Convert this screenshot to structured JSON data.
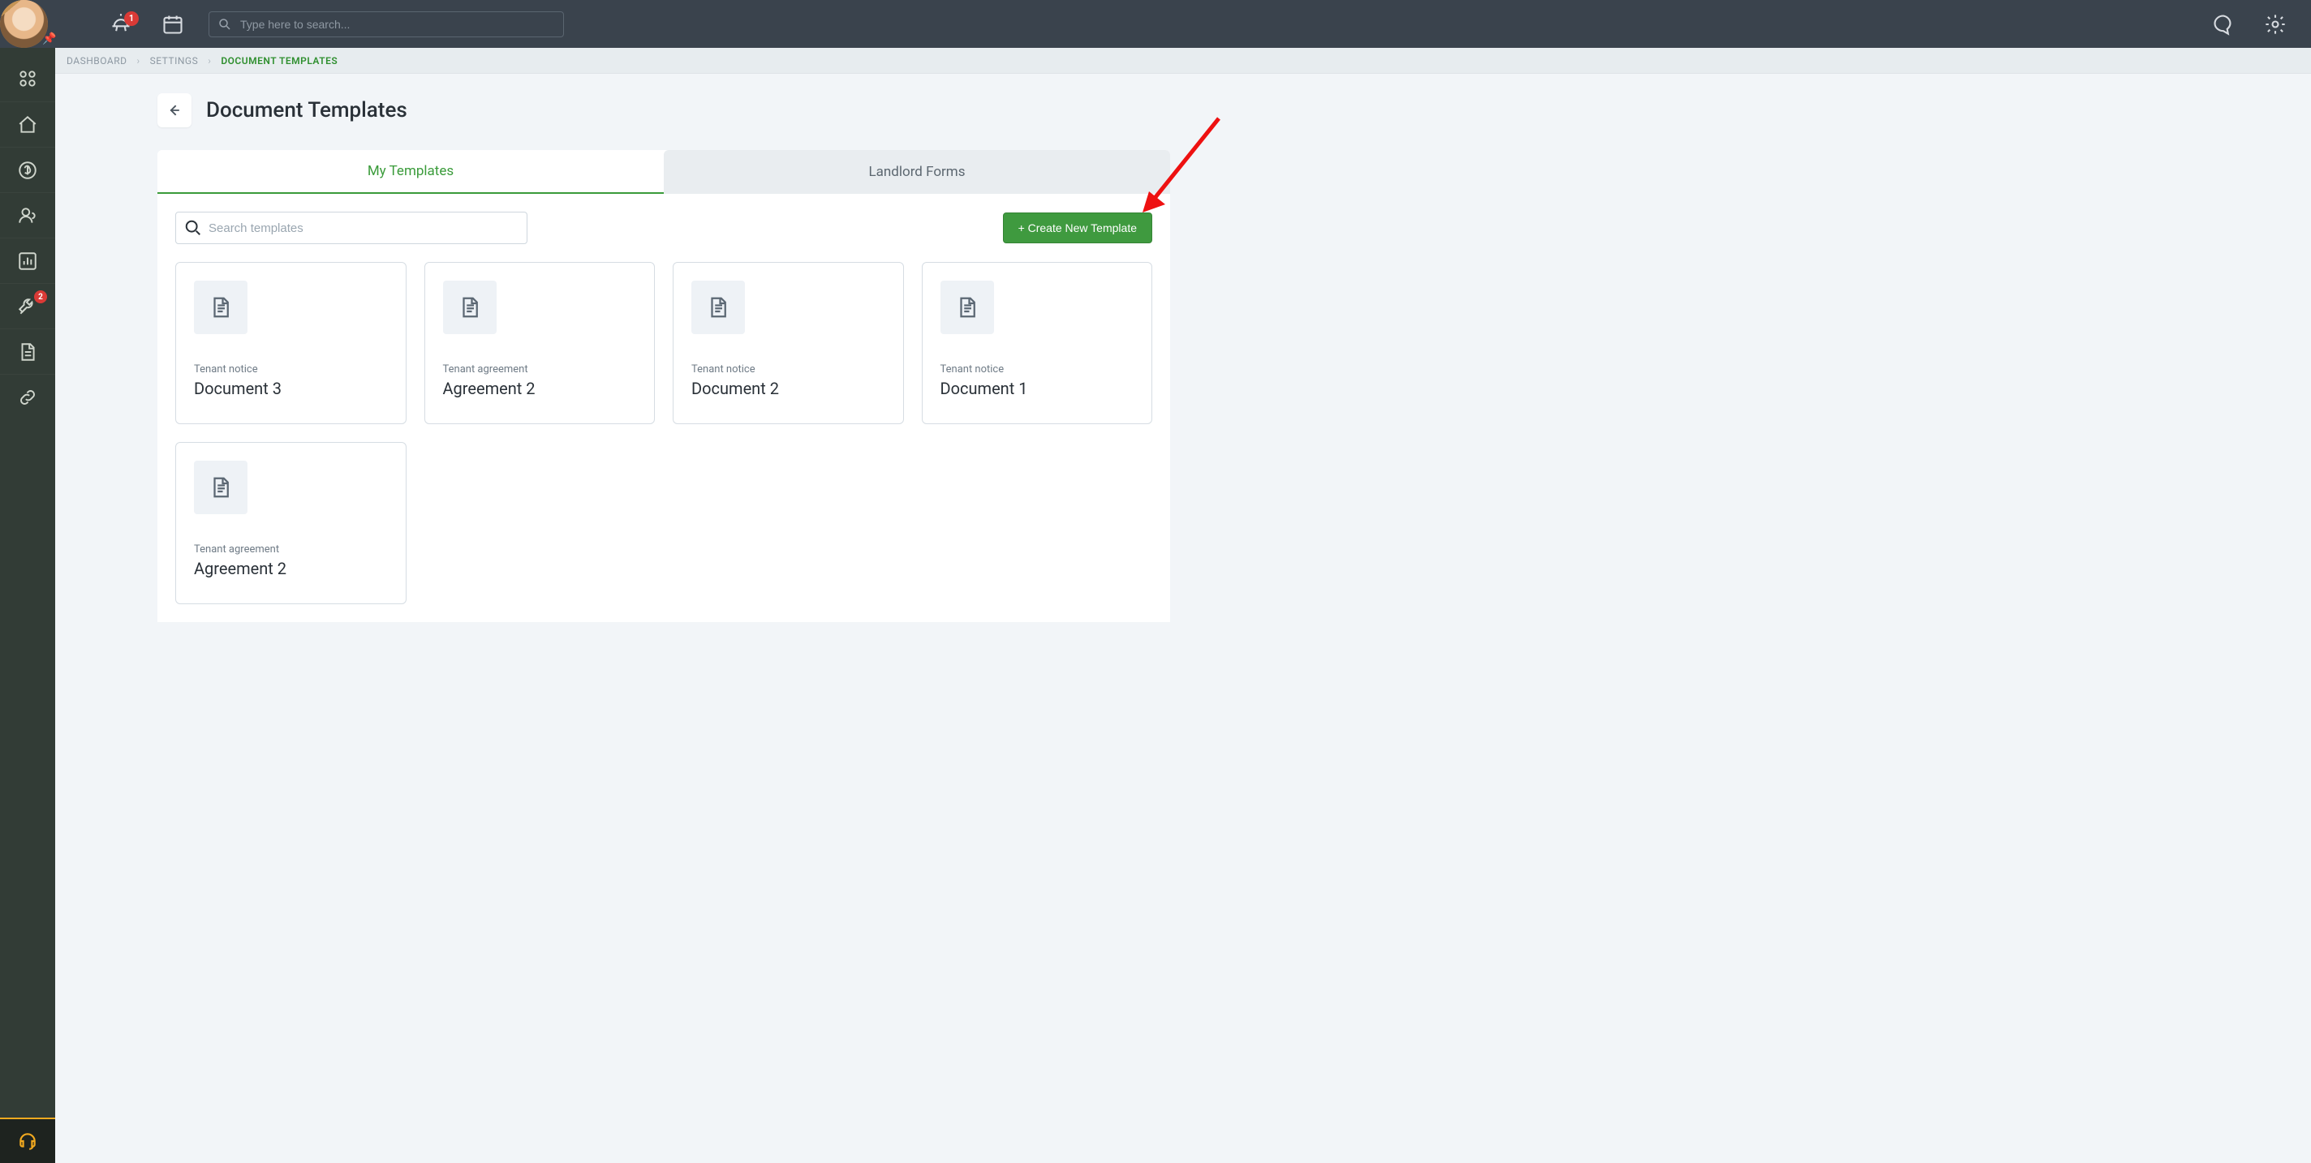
{
  "topbar": {
    "notification_badge": "1",
    "search_placeholder": "Type here to search..."
  },
  "sidebar": {
    "maint_badge": "2"
  },
  "breadcrumbs": {
    "items": [
      "DASHBOARD",
      "SETTINGS",
      "DOCUMENT TEMPLATES"
    ]
  },
  "page": {
    "title": "Document Templates"
  },
  "tabs": {
    "my_templates": "My Templates",
    "landlord_forms": "Landlord Forms"
  },
  "toolbar": {
    "search_placeholder": "Search templates",
    "create_label": "+ Create New Template"
  },
  "templates": [
    {
      "category": "Tenant notice",
      "name": "Document 3"
    },
    {
      "category": "Tenant agreement",
      "name": "Agreement 2"
    },
    {
      "category": "Tenant notice",
      "name": "Document 2"
    },
    {
      "category": "Tenant notice",
      "name": "Document 1"
    },
    {
      "category": "Tenant agreement",
      "name": "Agreement 2"
    }
  ]
}
